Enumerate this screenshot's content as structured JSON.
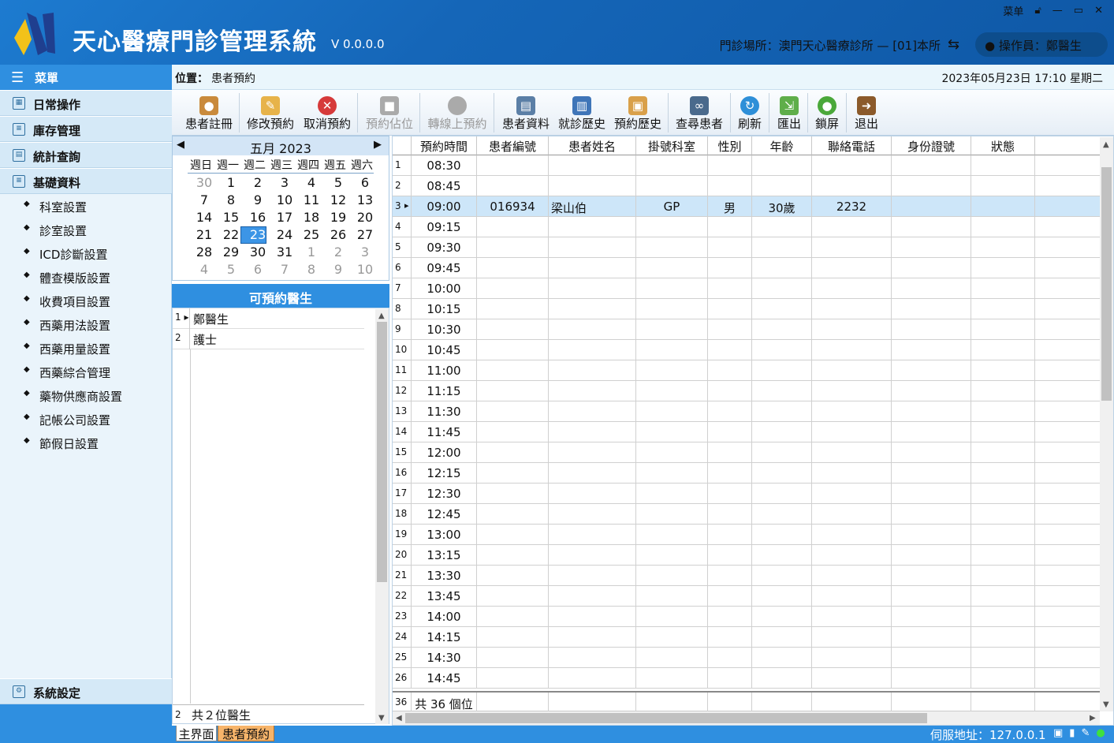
{
  "header": {
    "title": "天心醫療門診管理系統",
    "version": "V 0.0.0.0",
    "window_menu": "菜单",
    "clinic": "門診場所：澳門天心醫療診所 — [01]本所",
    "operator": "操作員：鄭醫生",
    "brand_color": "#1566b8"
  },
  "sidebar": {
    "head": "菜單",
    "sections": [
      "日常操作",
      "庫存管理",
      "統計查詢",
      "基礎資料"
    ],
    "items": [
      "科室設置",
      "診室設置",
      "ICD診斷設置",
      "體查模版設置",
      "收費項目設置",
      "西藥用法設置",
      "西藥用量設置",
      "西藥綜合管理",
      "藥物供應商設置",
      "記帳公司設置",
      "節假日設置"
    ],
    "footer_section": "系統設定"
  },
  "location": {
    "label": "位置：",
    "value": "患者預約",
    "datetime": "2023年05月23日 17:10 星期二"
  },
  "toolbar": {
    "buttons": [
      {
        "label": "患者註冊",
        "icon": "person-icon",
        "enabled": true
      },
      {
        "label": "修改預約",
        "icon": "edit-icon",
        "enabled": true
      },
      {
        "label": "取消預約",
        "icon": "cancel-icon",
        "enabled": true
      },
      {
        "label": "預約佔位",
        "icon": "lock-icon",
        "enabled": false
      },
      {
        "label": "轉線上預約",
        "icon": "circle-icon",
        "enabled": false
      },
      {
        "label": "患者資料",
        "icon": "id-card-icon",
        "enabled": true
      },
      {
        "label": "就診歷史",
        "icon": "book-icon",
        "enabled": true
      },
      {
        "label": "預約歷史",
        "icon": "clipboard-icon",
        "enabled": true
      },
      {
        "label": "查尋患者",
        "icon": "binoculars-icon",
        "enabled": true
      },
      {
        "label": "刷新",
        "icon": "refresh-icon",
        "enabled": true
      },
      {
        "label": "匯出",
        "icon": "export-icon",
        "enabled": true
      },
      {
        "label": "鎖屏",
        "icon": "lock-screen-icon",
        "enabled": true
      },
      {
        "label": "退出",
        "icon": "exit-icon",
        "enabled": true
      }
    ]
  },
  "calendar": {
    "month_label": "五月 2023",
    "weekdays": [
      "週日",
      "週一",
      "週二",
      "週三",
      "週四",
      "週五",
      "週六"
    ],
    "weeks": [
      [
        "30",
        "1",
        "2",
        "3",
        "4",
        "5",
        "6"
      ],
      [
        "7",
        "8",
        "9",
        "10",
        "11",
        "12",
        "13"
      ],
      [
        "14",
        "15",
        "16",
        "17",
        "18",
        "19",
        "20"
      ],
      [
        "21",
        "22",
        "23",
        "24",
        "25",
        "26",
        "27"
      ],
      [
        "28",
        "29",
        "30",
        "31",
        "1",
        "2",
        "3"
      ],
      [
        "4",
        "5",
        "6",
        "7",
        "8",
        "9",
        "10"
      ]
    ],
    "selected": "23"
  },
  "doctors": {
    "title": "可預約醫生",
    "rows": [
      {
        "no": "1",
        "name": "鄭醫生"
      },
      {
        "no": "2",
        "name": "護士"
      }
    ],
    "footer_no": "2",
    "footer_text": "共２位醫生"
  },
  "grid": {
    "columns": [
      "預約時間",
      "患者編號",
      "患者姓名",
      "掛號科室",
      "性別",
      "年齡",
      "聯絡電話",
      "身份證號",
      "狀態"
    ],
    "rows": [
      {
        "no": "1",
        "time": "08:30"
      },
      {
        "no": "2",
        "time": "08:45"
      },
      {
        "no": "3",
        "time": "09:00",
        "id": "016934",
        "name": "梁山伯",
        "dept": "GP",
        "sex": "男",
        "age": "30歲",
        "phone": "2232"
      },
      {
        "no": "4",
        "time": "09:15"
      },
      {
        "no": "5",
        "time": "09:30"
      },
      {
        "no": "6",
        "time": "09:45"
      },
      {
        "no": "7",
        "time": "10:00"
      },
      {
        "no": "8",
        "time": "10:15"
      },
      {
        "no": "9",
        "time": "10:30"
      },
      {
        "no": "10",
        "time": "10:45"
      },
      {
        "no": "11",
        "time": "11:00"
      },
      {
        "no": "12",
        "time": "11:15"
      },
      {
        "no": "13",
        "time": "11:30"
      },
      {
        "no": "14",
        "time": "11:45"
      },
      {
        "no": "15",
        "time": "12:00"
      },
      {
        "no": "16",
        "time": "12:15"
      },
      {
        "no": "17",
        "time": "12:30"
      },
      {
        "no": "18",
        "time": "12:45"
      },
      {
        "no": "19",
        "time": "13:00"
      },
      {
        "no": "20",
        "time": "13:15"
      },
      {
        "no": "21",
        "time": "13:30"
      },
      {
        "no": "22",
        "time": "13:45"
      },
      {
        "no": "23",
        "time": "14:00"
      },
      {
        "no": "24",
        "time": "14:15"
      },
      {
        "no": "25",
        "time": "14:30"
      },
      {
        "no": "26",
        "time": "14:45"
      }
    ],
    "footer_no": "36",
    "footer_text": "共 36 個位"
  },
  "status": {
    "tabs": [
      "主界面",
      "患者預約"
    ],
    "server": "伺服地址：127.0.0.1"
  }
}
